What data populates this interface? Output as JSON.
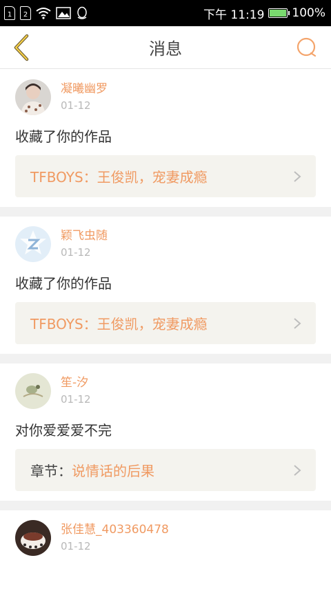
{
  "status_bar": {
    "sim1": "1",
    "sim2": "2",
    "time": "下午 11:19",
    "battery": "100%",
    "battery_level": 1.0
  },
  "header": {
    "title": "消息"
  },
  "messages": [
    {
      "username": "凝曦幽罗",
      "date": "01-12",
      "text": "收藏了你的作品",
      "link_prefix": "",
      "link_text": "TFBOYS：王俊凯，宠妻成瘾"
    },
    {
      "username": "颖飞虫随",
      "date": "01-12",
      "text": "收藏了你的作品",
      "link_prefix": "",
      "link_text": "TFBOYS：王俊凯，宠妻成瘾"
    },
    {
      "username": "笙-汐",
      "date": "01-12",
      "text": "对你爱爱爱不完",
      "link_prefix": "章节：",
      "link_text": "说情话的后果"
    },
    {
      "username": "张佳慧_403360478",
      "date": "01-12"
    }
  ]
}
